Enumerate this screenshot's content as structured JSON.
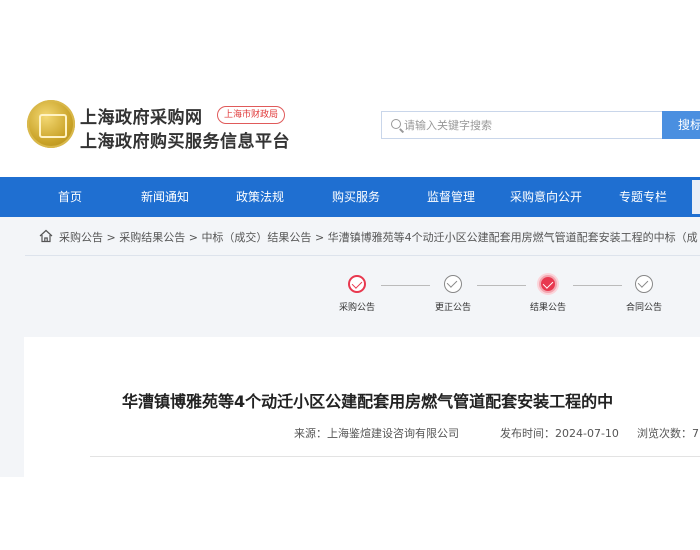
{
  "header": {
    "site_title_line1": "上海政府采购网",
    "site_title_line2": "上海政府购买服务信息平台",
    "badge": "上海市财政局",
    "logo_icon": "emblem-logo"
  },
  "search": {
    "placeholder": "请输入关键字搜索",
    "button_label": "搜标"
  },
  "nav": {
    "items": [
      "首页",
      "新闻通知",
      "政策法规",
      "购买服务",
      "监督管理",
      "采购意向公开",
      "专题专栏"
    ]
  },
  "breadcrumb": {
    "items": [
      "采购公告",
      "采购结果公告",
      "中标（成交）结果公告",
      "华漕镇博雅苑等4个动迁小区公建配套用房燃气管道配套安装工程的中标（成"
    ],
    "separator": ">"
  },
  "steps": [
    {
      "label": "采购公告",
      "state": "active"
    },
    {
      "label": "更正公告",
      "state": "done"
    },
    {
      "label": "结果公告",
      "state": "current"
    },
    {
      "label": "合同公告",
      "state": "done"
    }
  ],
  "article": {
    "title": "华漕镇博雅苑等4个动迁小区公建配套用房燃气管道配套安装工程的中",
    "source": "来源：上海鉴煊建设咨询有限公司",
    "publish_time": "发布时间：2024-07-10",
    "views": "浏览次数：7"
  },
  "colors": {
    "nav_bg": "#1f6fd1",
    "accent_red": "#e8384f",
    "search_button": "#4a8fe0"
  }
}
